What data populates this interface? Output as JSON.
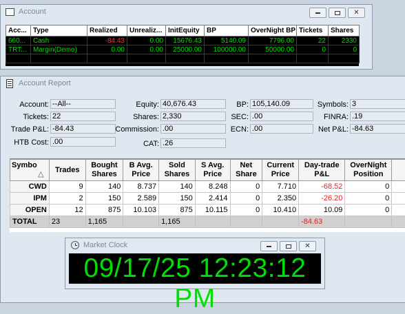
{
  "account_window": {
    "title": "Account",
    "columns": [
      "Acc...",
      "Type",
      "Realized",
      "Unrealiz...",
      "InitEquity",
      "BP",
      "OverNight BP",
      "Tickets",
      "Shares"
    ],
    "rows": [
      [
        "660...",
        "Cash",
        "-84.43",
        "0.00",
        "15676.43",
        "5140.09",
        "7796.00",
        "22",
        "2330"
      ],
      [
        "TRT...",
        "Margin(Demo)",
        "0.00",
        "0.00",
        "25000.00",
        "100000.00",
        "50000.00",
        "0",
        "0"
      ]
    ],
    "negative_color": "#ff3030",
    "value_color": "#00e000"
  },
  "report_window": {
    "title": "Account Report",
    "fields": {
      "account": {
        "label": "Account:",
        "value": "--All--"
      },
      "tickets": {
        "label": "Tickets:",
        "value": "22"
      },
      "trade_pl": {
        "label": "Trade P&L:",
        "value": "-84.43"
      },
      "htb_cost": {
        "label": "HTB Cost:",
        "value": ".00"
      },
      "equity": {
        "label": "Equity:",
        "value": "40,676.43"
      },
      "shares": {
        "label": "Shares:",
        "value": "2,330"
      },
      "commission": {
        "label": "Commission:",
        "value": ".00"
      },
      "cat": {
        "label": "CAT:",
        "value": ".26"
      },
      "bp": {
        "label": "BP:",
        "value": "105,140.09"
      },
      "sec": {
        "label": "SEC:",
        "value": ".00"
      },
      "ecn": {
        "label": "ECN:",
        "value": ".00"
      },
      "symbols": {
        "label": "Symbols:",
        "value": "3"
      },
      "finra": {
        "label": "FINRA:",
        "value": ".19"
      },
      "net_pl": {
        "label": "Net P&L:",
        "value": "-84.63"
      }
    },
    "columns": [
      "Symbo",
      "Trades",
      "Bought Shares",
      "B Avg. Price",
      "Sold Shares",
      "S Avg. Price",
      "Net Share",
      "Current Price",
      "Day-trade P&L",
      "OverNight Position"
    ],
    "sort_indicator": "△",
    "rows": [
      [
        "CWD",
        "9",
        "140",
        "8.737",
        "140",
        "8.248",
        "0",
        "7.710",
        "-68.52",
        "0"
      ],
      [
        "IPM",
        "2",
        "150",
        "2.589",
        "150",
        "2.414",
        "0",
        "2.350",
        "-26.20",
        "0"
      ],
      [
        "OPEN",
        "12",
        "875",
        "10.103",
        "875",
        "10.115",
        "0",
        "10.410",
        "10.09",
        "0"
      ]
    ],
    "total": [
      "TOTAL",
      "23",
      "1,165",
      "",
      "1,165",
      "",
      "",
      "",
      "-84.63",
      ""
    ]
  },
  "clock_window": {
    "title": "Market Clock",
    "time": "09/17/25 12:23:12 PM"
  }
}
